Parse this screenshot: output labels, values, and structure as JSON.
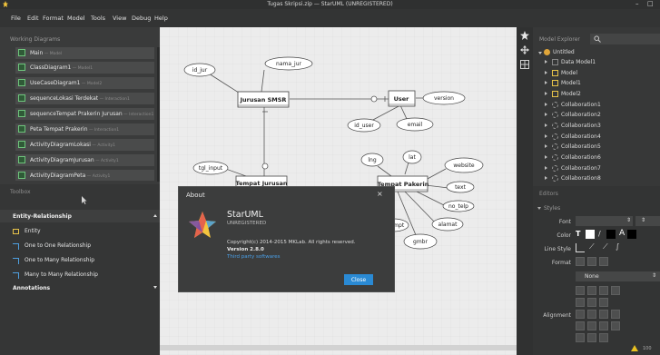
{
  "window": {
    "title": "Tugas Skripsi.zip — StarUML (UNREGISTERED)",
    "min_label": "–",
    "max_label": "□"
  },
  "menu": [
    "File",
    "Edit",
    "Format",
    "Model",
    "Tools",
    "View",
    "Debug",
    "Help"
  ],
  "working_diagrams": {
    "header": "Working Diagrams",
    "items": [
      {
        "label": "Main",
        "sub": " — Model"
      },
      {
        "label": "ClassDiagram1",
        "sub": " — Model1"
      },
      {
        "label": "UseCaseDiagram1",
        "sub": " — Model2"
      },
      {
        "label": "sequenceLokasi Terdekat",
        "sub": " — Interaction1"
      },
      {
        "label": "sequenceTempat Prakerin Jurusan",
        "sub": " — Interaction1"
      },
      {
        "label": "Peta Tempat Prakerin",
        "sub": " — Interaction1"
      },
      {
        "label": "ActivityDiagramLokasi",
        "sub": " — Activity1"
      },
      {
        "label": "ActivityDiagramJurusan",
        "sub": " — Activity1"
      },
      {
        "label": "ActivityDiagramPeta",
        "sub": " — Activity1"
      }
    ]
  },
  "toolbox": {
    "header": "Toolbox",
    "section": "Entity-Relationship",
    "items": [
      "Entity",
      "One to One Relationship",
      "One to Many Relationship",
      "Many to Many Relationship"
    ],
    "annotations": "Annotations"
  },
  "diagram": {
    "entities": {
      "jurusan": "Jurusan SMSR",
      "user": "User",
      "tempat_jurusan": "Tempat Jurusan",
      "tempat_pakerin": "Tempat Pakerin"
    },
    "attributes": {
      "id_jur": "id_jur",
      "nama_jur": "nama_jur",
      "version": "version",
      "id_user": "id_user",
      "email": "email",
      "tgl_input": "tgl_input",
      "lng": "lng",
      "lat": "lat",
      "website": "website",
      "text": "text",
      "no_telp": "no_telp",
      "tmpt": "tmpt",
      "alamat": "alamat",
      "gmbr": "gmbr"
    }
  },
  "model_explorer": {
    "header": "Model Explorer",
    "search_icon": "search-icon",
    "items": [
      {
        "label": "Untitled",
        "level": 0
      },
      {
        "label": "Data Model1",
        "level": 1
      },
      {
        "label": "Model",
        "level": 1
      },
      {
        "label": "Model1",
        "level": 1
      },
      {
        "label": "Model2",
        "level": 1
      },
      {
        "label": "Collaboration1",
        "level": 1
      },
      {
        "label": "Collaboration2",
        "level": 1
      },
      {
        "label": "Collaboration3",
        "level": 1
      },
      {
        "label": "Collaboration4",
        "level": 1
      },
      {
        "label": "Collaboration5",
        "level": 1
      },
      {
        "label": "Collaboration6",
        "level": 1
      },
      {
        "label": "Collaboration7",
        "level": 1
      },
      {
        "label": "Collaboration8",
        "level": 1
      }
    ]
  },
  "editors": {
    "header": "Editors",
    "styles": "Styles",
    "font_label": "Font",
    "color_label": "Color",
    "line_style_label": "Line Style",
    "format_label": "Format",
    "format_value": "None",
    "alignment_label": "Alignment",
    "font_a": "A"
  },
  "about": {
    "title": "About",
    "app_name": "StarUML",
    "registration": "UNREGISTERED",
    "copyright": "Copyright(c) 2014-2015 MKLab. All rights reserved.",
    "version": "Version 2.8.0",
    "link": "Third party softwares",
    "close_button": "Close"
  },
  "status": {
    "zoom": "100"
  },
  "colors": {
    "accent": "#2a8ad4",
    "selected_green": "#6fc47c"
  }
}
